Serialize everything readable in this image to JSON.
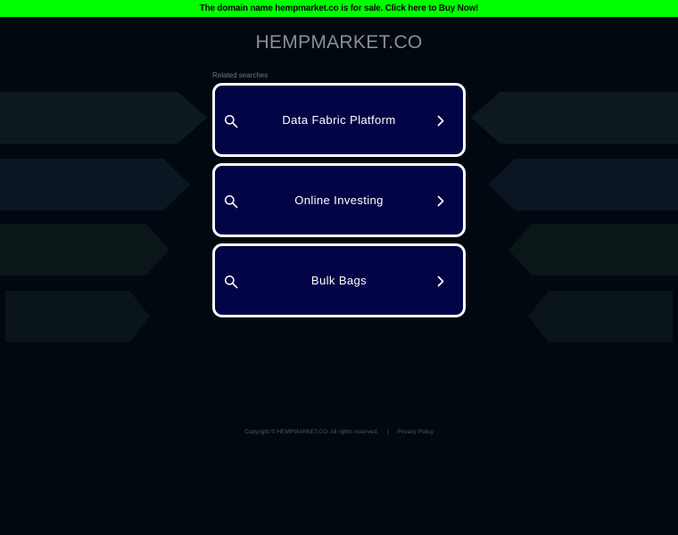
{
  "banner": {
    "text": "The domain name hempmarket.co is for sale. Click here to Buy Now!"
  },
  "site": {
    "title": "HEMPMARKET.CO"
  },
  "related": {
    "label": "Related searches",
    "items": [
      {
        "label": "Data Fabric Platform",
        "icon": "search-icon",
        "arrow": "chevron-right-icon"
      },
      {
        "label": "Online Investing",
        "icon": "search-icon",
        "arrow": "chevron-right-icon"
      },
      {
        "label": "Bulk Bags",
        "icon": "search-icon",
        "arrow": "chevron-right-icon"
      }
    ]
  },
  "footer": {
    "copyright": "Copyright © HEMPMARKET.CO.  All rights reserved.",
    "separator": "|",
    "privacy": "Privacy Policy"
  },
  "colors": {
    "banner_bg": "#00ff00",
    "page_bg": "#020810",
    "button_bg": "#020446",
    "button_border": "#ffffff"
  }
}
